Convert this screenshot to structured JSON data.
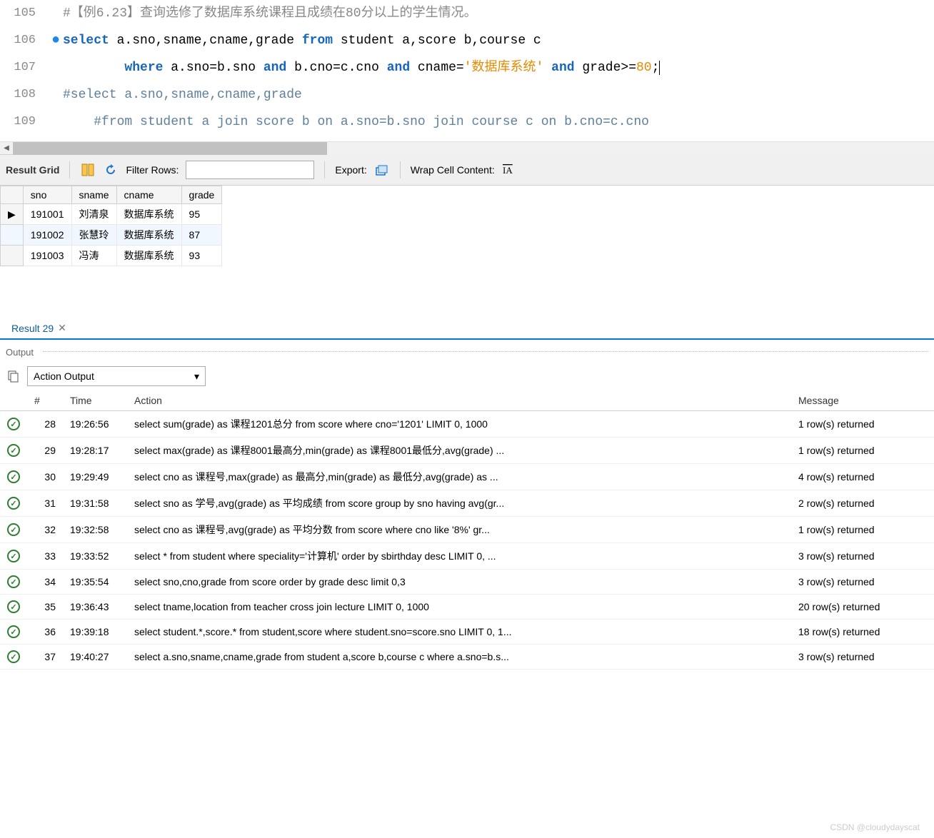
{
  "code": {
    "lines": [
      {
        "num": "105",
        "bullet": false
      },
      {
        "num": "106",
        "bullet": true
      },
      {
        "num": "107",
        "bullet": false
      },
      {
        "num": "108",
        "bullet": false
      },
      {
        "num": "109",
        "bullet": false
      }
    ],
    "l105_comment": "#【例6.23】查询选修了数据库系统课程且成绩在80分以上的学生情况。",
    "l106_kw_select": "select",
    "l106_cols": " a.sno,sname,cname,grade ",
    "l106_kw_from": "from",
    "l106_tables": " student a,score b,course c",
    "l107_indent": "        ",
    "l107_kw_where": "where",
    "l107_c1": " a.sno=b.sno ",
    "l107_kw_and1": "and",
    "l107_c2": " b.cno=c.cno ",
    "l107_kw_and2": "and",
    "l107_c3": " cname=",
    "l107_str": "'数据库系统'",
    "l107_sp": " ",
    "l107_kw_and3": "and",
    "l107_c4": " grade>=",
    "l107_num": "80",
    "l107_semi": ";",
    "l108_text": "#select a.sno,sname,cname,grade",
    "l109_indent": "    ",
    "l109_text": "#from student a join score b on a.sno=b.sno join course c on b.cno=c.cno"
  },
  "toolbar": {
    "result_grid": "Result Grid",
    "filter_rows": "Filter Rows:",
    "export": "Export:",
    "wrap_cell": "Wrap Cell Content:"
  },
  "grid": {
    "headers": [
      "sno",
      "sname",
      "cname",
      "grade"
    ],
    "rows": [
      {
        "marker": "▶",
        "cells": [
          "191001",
          "刘清泉",
          "数据库系统",
          "95"
        ]
      },
      {
        "marker": "",
        "cells": [
          "191002",
          "张慧玲",
          "数据库系统",
          "87"
        ]
      },
      {
        "marker": "",
        "cells": [
          "191003",
          "冯涛",
          "数据库系统",
          "93"
        ]
      }
    ]
  },
  "result_tab": "Result 29",
  "output_label": "Output",
  "action_output": "Action Output",
  "output_cols": {
    "idx": "#",
    "time": "Time",
    "action": "Action",
    "msg": "Message"
  },
  "output_rows": [
    {
      "idx": "28",
      "time": "19:26:56",
      "action": "select sum(grade) as 课程1201总分 from score where cno='1201' LIMIT 0, 1000",
      "msg": "1 row(s) returned"
    },
    {
      "idx": "29",
      "time": "19:28:17",
      "action": "select max(grade) as 课程8001最高分,min(grade) as 课程8001最低分,avg(grade) ...",
      "msg": "1 row(s) returned"
    },
    {
      "idx": "30",
      "time": "19:29:49",
      "action": "select cno as 课程号,max(grade) as 最高分,min(grade) as 最低分,avg(grade) as ...",
      "msg": "4 row(s) returned"
    },
    {
      "idx": "31",
      "time": "19:31:58",
      "action": "select sno as 学号,avg(grade) as 平均成绩 from score group by sno having avg(gr...",
      "msg": "2 row(s) returned"
    },
    {
      "idx": "32",
      "time": "19:32:58",
      "action": "select cno as 课程号,avg(grade) as 平均分数 from score where cno like '8%'    gr...",
      "msg": "1 row(s) returned"
    },
    {
      "idx": "33",
      "time": "19:33:52",
      "action": "select * from student where speciality='计算机'    order by sbirthday desc LIMIT 0, ...",
      "msg": "3 row(s) returned"
    },
    {
      "idx": "34",
      "time": "19:35:54",
      "action": "select sno,cno,grade from score order by grade desc    limit 0,3",
      "msg": "3 row(s) returned"
    },
    {
      "idx": "35",
      "time": "19:36:43",
      "action": "select tname,location from teacher cross join lecture LIMIT 0, 1000",
      "msg": "20 row(s) returned"
    },
    {
      "idx": "36",
      "time": "19:39:18",
      "action": "select student.*,score.* from student,score where student.sno=score.sno LIMIT 0, 1...",
      "msg": "18 row(s) returned"
    },
    {
      "idx": "37",
      "time": "19:40:27",
      "action": "select a.sno,sname,cname,grade from student a,score b,course c where a.sno=b.s...",
      "msg": "3 row(s) returned"
    }
  ],
  "watermark": "CSDN @cloudydayscat"
}
